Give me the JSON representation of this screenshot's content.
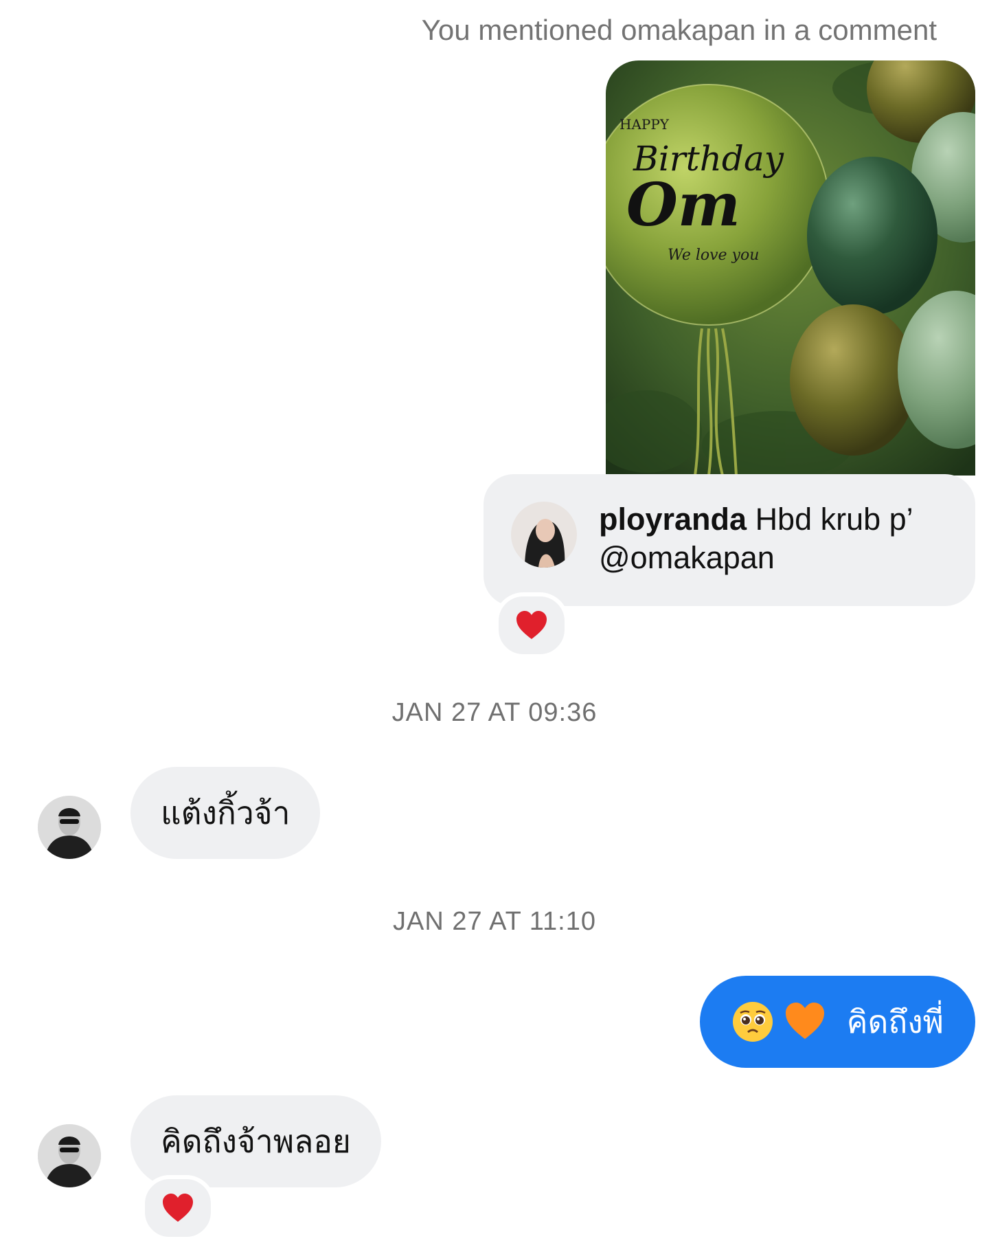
{
  "thread": {
    "mention_note": "You mentioned omakapan in a comment",
    "shared_post": {
      "image_text": {
        "line1": "HAPPY",
        "line2": "Birthday",
        "line3": "Om",
        "line4": "We love you"
      }
    },
    "comment": {
      "username": "ployranda",
      "text": "Hbd krub p’ @omakapan",
      "reaction": "heart-icon"
    },
    "messages": [
      {
        "timestamp": "JAN 27 AT 09:36"
      },
      {
        "from": "them",
        "text": "แต้งกิ้วจ้า"
      },
      {
        "timestamp": "JAN 27 AT 11:10"
      },
      {
        "from": "me",
        "emojis": [
          "pleading-face-icon",
          "orange-heart-icon"
        ],
        "text": "คิดถึงพี่"
      },
      {
        "from": "them",
        "text": "คิดถึงจ้าพลอย",
        "reaction": "heart-icon"
      }
    ]
  },
  "colors": {
    "outgoing_bubble": "#1c7cf2",
    "incoming_bubble": "#eff0f2",
    "heart": "#e0202c",
    "orange_heart": "#ff8a1c"
  }
}
